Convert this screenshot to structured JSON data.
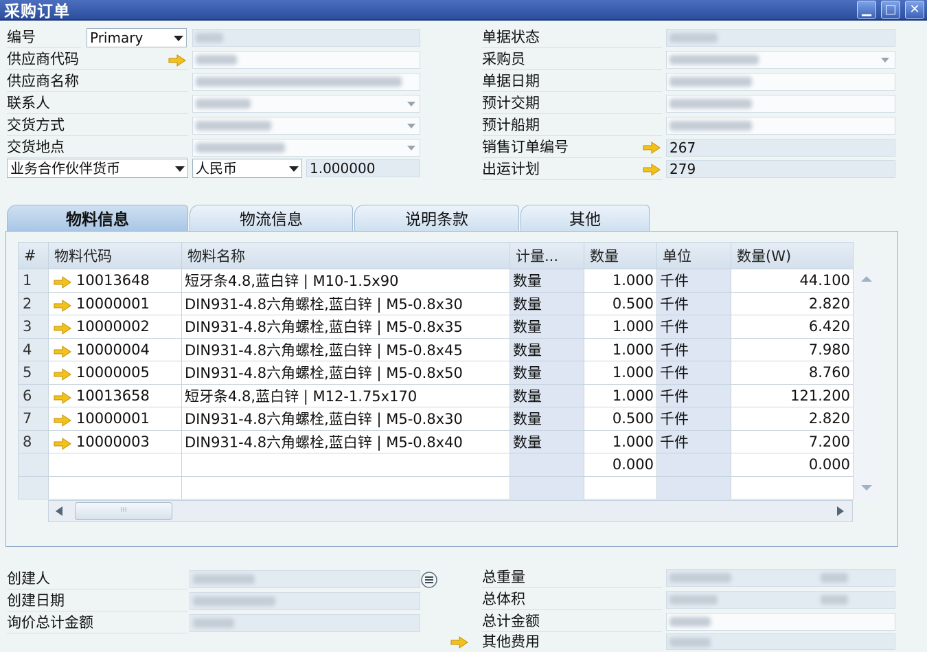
{
  "window": {
    "title": "采购订单",
    "minimize": "▁",
    "maximize": "□",
    "close": "✕"
  },
  "header_left": {
    "doc_no_label": "编号",
    "series": "Primary",
    "supplier_code_label": "供应商代码",
    "supplier_name_label": "供应商名称",
    "contact_label": "联系人",
    "delivery_method_label": "交货方式",
    "delivery_place_label": "交货地点",
    "bp_currency_label": "业务合作伙伴货币",
    "currency": "人民币",
    "exchange_rate": "1.000000"
  },
  "header_right": {
    "status_label": "单据状态",
    "buyer_label": "采购员",
    "doc_date_label": "单据日期",
    "delivery_date_label": "预计交期",
    "ship_date_label": "预计船期",
    "sales_order_label": "销售订单编号",
    "sales_order_no": "267",
    "shipping_plan_label": "出运计划",
    "shipping_plan_no": "279"
  },
  "tabs": [
    {
      "label": "物料信息",
      "active": true
    },
    {
      "label": "物流信息",
      "active": false
    },
    {
      "label": "说明条款",
      "active": false
    },
    {
      "label": "其他",
      "active": false
    }
  ],
  "grid": {
    "columns": [
      "#",
      "物料代码",
      "物料名称",
      "计量...",
      "数量",
      "单位",
      "数量(W)"
    ],
    "rows": [
      {
        "n": "1",
        "code": "10013648",
        "name": "短牙条4.8,蓝白锌 | M10-1.5x90",
        "uom": "数量",
        "qty": "1.000",
        "unit": "千件",
        "qtyw": "44.100"
      },
      {
        "n": "2",
        "code": "10000001",
        "name": "DIN931-4.8六角螺栓,蓝白锌 | M5-0.8x30",
        "uom": "数量",
        "qty": "0.500",
        "unit": "千件",
        "qtyw": "2.820"
      },
      {
        "n": "3",
        "code": "10000002",
        "name": "DIN931-4.8六角螺栓,蓝白锌 | M5-0.8x35",
        "uom": "数量",
        "qty": "1.000",
        "unit": "千件",
        "qtyw": "6.420"
      },
      {
        "n": "4",
        "code": "10000004",
        "name": "DIN931-4.8六角螺栓,蓝白锌 | M5-0.8x45",
        "uom": "数量",
        "qty": "1.000",
        "unit": "千件",
        "qtyw": "7.980"
      },
      {
        "n": "5",
        "code": "10000005",
        "name": "DIN931-4.8六角螺栓,蓝白锌 | M5-0.8x50",
        "uom": "数量",
        "qty": "1.000",
        "unit": "千件",
        "qtyw": "8.760"
      },
      {
        "n": "6",
        "code": "10013658",
        "name": "短牙条4.8,蓝白锌 | M12-1.75x170",
        "uom": "数量",
        "qty": "1.000",
        "unit": "千件",
        "qtyw": "121.200"
      },
      {
        "n": "7",
        "code": "10000001",
        "name": "DIN931-4.8六角螺栓,蓝白锌 | M5-0.8x30",
        "uom": "数量",
        "qty": "0.500",
        "unit": "千件",
        "qtyw": "2.820"
      },
      {
        "n": "8",
        "code": "10000003",
        "name": "DIN931-4.8六角螺栓,蓝白锌 | M5-0.8x40",
        "uom": "数量",
        "qty": "1.000",
        "unit": "千件",
        "qtyw": "7.200"
      }
    ],
    "empty_row": {
      "qty": "0.000",
      "qtyw": "0.000"
    }
  },
  "footer_left": {
    "creator_label": "创建人",
    "create_date_label": "创建日期",
    "inquiry_total_label": "询价总计金额"
  },
  "footer_right": {
    "total_weight_label": "总重量",
    "total_volume_label": "总体积",
    "total_amount_label": "总计金额",
    "other_fees_label": "其他费用"
  },
  "colors": {
    "titlebar": "#2c4e9d",
    "arrow": "#f2c21b",
    "field": "#e3ebf2",
    "background": "#eef5f4"
  }
}
